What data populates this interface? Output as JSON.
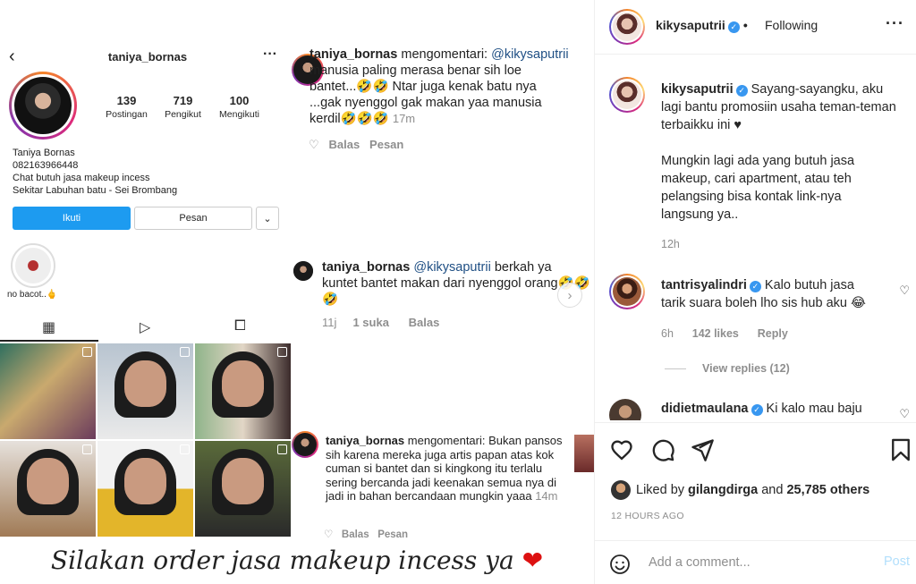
{
  "post_image": {
    "profile": {
      "username": "taniya_bornas",
      "stats": [
        {
          "value": "139",
          "label": "Postingan"
        },
        {
          "value": "719",
          "label": "Pengikut"
        },
        {
          "value": "100",
          "label": "Mengikuti"
        }
      ],
      "bio": [
        "Taniya Bornas",
        "082163966448",
        "Chat butuh jasa makeup incess",
        "Sekitar Labuhan batu - Sei Brombang"
      ],
      "follow_label": "Ikuti",
      "message_label": "Pesan",
      "highlight_label": "no bacot..🖕"
    },
    "comments": [
      {
        "user": "taniya_bornas",
        "verb": "mengomentari:",
        "mention": "@kikysaputrii",
        "text": "manusia paling merasa benar sih loe bantet...🤣🤣 Ntar juga kenak batu nya ...gak nyenggol gak makan yaa manusia kerdil🤣🤣🤣",
        "time": "17m",
        "reply": "Balas",
        "message": "Pesan"
      },
      {
        "user": "taniya_bornas",
        "mention": "@kikysaputrii",
        "text": "berkah ya kuntet bantet makan dari nyenggol orang🤣🤣🤣",
        "time": "11j",
        "likes": "1 suka",
        "reply": "Balas"
      },
      {
        "user": "taniya_bornas",
        "verb": "mengomentari:",
        "text": "Bukan pansos sih karena mereka juga artis papan atas kok cuman si bantet dan si kingkong itu terlalu sering bercanda jadi keenakan semua nya di jadi in bahan bercandaan mungkin yaaa",
        "time": "14m",
        "reply": "Balas",
        "message": "Pesan"
      }
    ],
    "caption_art": "Silakan order jasa makeup incess ya",
    "caption_heart": "❤"
  },
  "panel": {
    "header": {
      "username": "kikysaputrii",
      "follow_status": "Following"
    },
    "caption": {
      "username": "kikysaputrii",
      "text_1": "Sayang-sayangku, aku lagi bantu promosiin usaha teman-teman terbaikku ini ♥",
      "text_2": "Mungkin lagi ada yang butuh jasa makeup, cari apartment, atau teh pelangsing bisa kontak link-nya langsung ya..",
      "time": "12h"
    },
    "comments": [
      {
        "username": "tantrisyalindri",
        "text": "Kalo butuh jasa tarik suara boleh lho sis hub aku 😂",
        "time": "6h",
        "likes": "142 likes",
        "reply": "Reply",
        "view_replies": "View replies (12)"
      },
      {
        "username": "didietmaulana",
        "text": "Ki kalo mau baju"
      }
    ],
    "liked_by": {
      "prefix": "Liked by",
      "user": "gilangdirga",
      "middle": "and",
      "count": "25,785 others"
    },
    "timestamp": "12 HOURS AGO",
    "add_comment": {
      "placeholder": "Add a comment...",
      "post_label": "Post"
    }
  }
}
